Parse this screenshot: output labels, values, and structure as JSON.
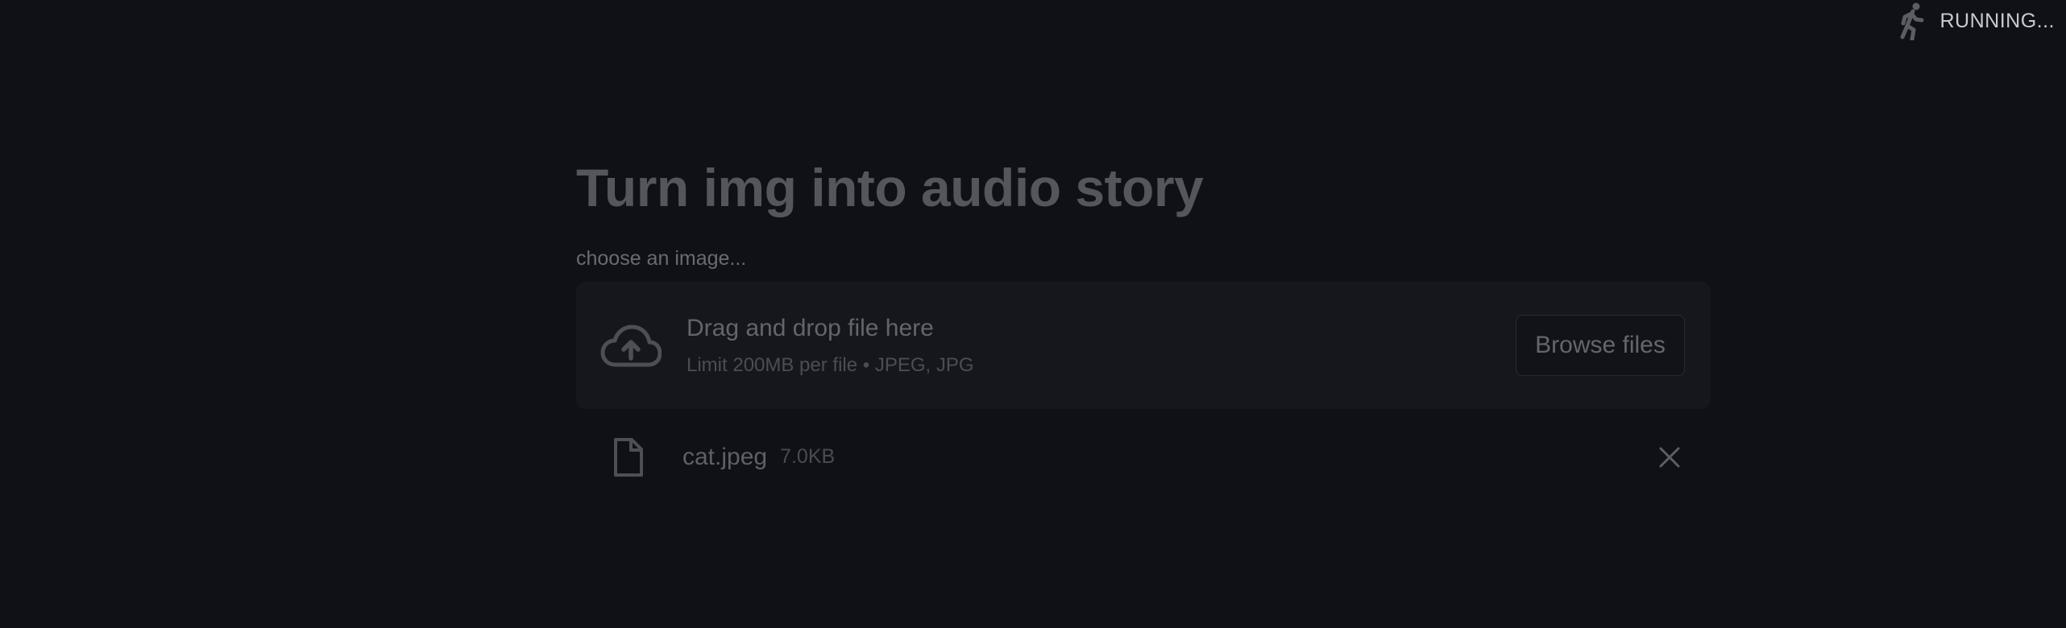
{
  "status": {
    "label": "RUNNING...",
    "icon": "running-person-icon"
  },
  "main": {
    "title": "Turn img into audio story",
    "uploader": {
      "label": "choose an image...",
      "dropzone_title": "Drag and drop file here",
      "dropzone_subtitle": "Limit 200MB per file • JPEG, JPG",
      "browse_label": "Browse files",
      "icon": "cloud-upload-icon"
    },
    "file": {
      "name": "cat.jpeg",
      "size": "7.0KB",
      "icon": "file-icon",
      "remove_icon": "close-icon"
    }
  },
  "colors": {
    "background": "#101116",
    "dropzone": "#16171c",
    "status_text": "#c9cad0"
  }
}
